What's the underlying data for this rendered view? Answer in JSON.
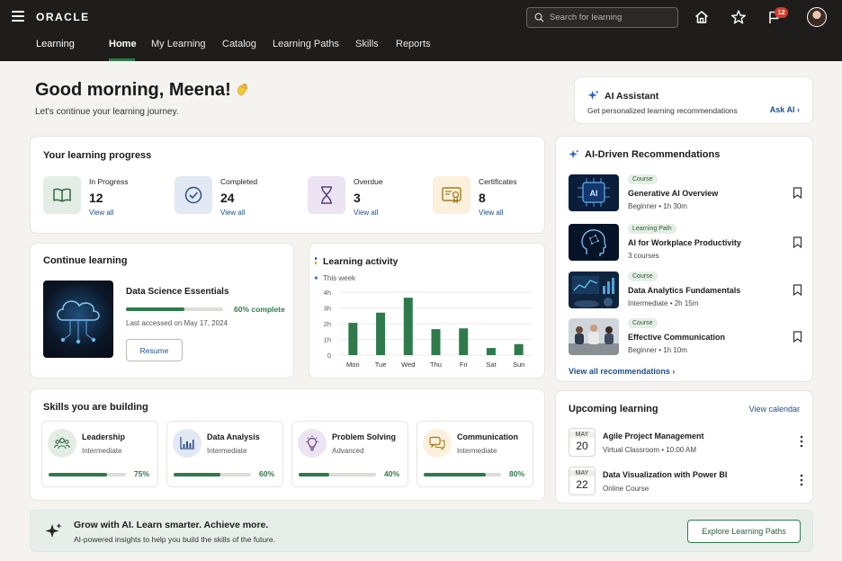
{
  "header": {
    "logo": "ORACLE",
    "search_placeholder": "Search for learning",
    "notification_count": "12",
    "app_name": "Learning",
    "tabs": [
      {
        "label": "Home",
        "active": true
      },
      {
        "label": "My Learning"
      },
      {
        "label": "Catalog"
      },
      {
        "label": "Learning Paths"
      },
      {
        "label": "Skills"
      },
      {
        "label": "Reports"
      }
    ]
  },
  "greeting": {
    "title": "Good morning, Meena!",
    "subtitle": "Let's continue your learning journey."
  },
  "ai_assistant": {
    "title": "AI Assistant",
    "subtitle": "Get personalized learning recommendations",
    "link": "Ask AI"
  },
  "progress": {
    "title": "Your learning progress",
    "stats": [
      {
        "label": "In Progress",
        "value": "12",
        "link": "View all",
        "icon": "book-icon",
        "color": "#e3ede5"
      },
      {
        "label": "Completed",
        "value": "24",
        "link": "View all",
        "icon": "check-circle-icon",
        "color": "#e2e9f5"
      },
      {
        "label": "Overdue",
        "value": "3",
        "link": "View all",
        "icon": "hourglass-icon",
        "color": "#ece4f2"
      },
      {
        "label": "Certificates",
        "value": "8",
        "link": "View all",
        "icon": "certificate-icon",
        "color": "#fbf0dc"
      }
    ]
  },
  "continue": {
    "title": "Continue learning",
    "course": "Data Science Essentials",
    "progress_pct": 60,
    "progress_label": "60% complete",
    "last_accessed": "Last accessed on May 17, 2024",
    "resume": "Resume"
  },
  "chart_data": {
    "type": "bar",
    "title": "Learning activity",
    "legend": "This week",
    "categories": [
      "Mon",
      "Tue",
      "Wed",
      "Thu",
      "Fri",
      "Sat",
      "Sun"
    ],
    "values": [
      2.05,
      2.7,
      3.65,
      1.65,
      1.7,
      0.45,
      0.7
    ],
    "yticks": [
      "4h",
      "3h",
      "2h",
      "1h",
      "0"
    ],
    "ylim": [
      0,
      4
    ],
    "color": "#2f7a4a"
  },
  "recommendations": {
    "title": "AI-Driven Recommendations",
    "items": [
      {
        "tag": "Course",
        "name": "Generative AI Overview",
        "meta": "Beginner  •  1h 30m"
      },
      {
        "tag": "Learning Path",
        "name": "AI for Workplace Productivity",
        "meta": "3 courses"
      },
      {
        "tag": "Course",
        "name": "Data Analytics Fundamentals",
        "meta": "Intermediate  •  2h 15m"
      },
      {
        "tag": "Course",
        "name": "Effective Communication",
        "meta": "Beginner  •  1h 10m"
      }
    ],
    "view_all": "View all recommendations"
  },
  "skills": {
    "title": "Skills you are building",
    "items": [
      {
        "name": "Leadership",
        "level": "Intermediate",
        "pct": 75,
        "pct_label": "75%",
        "icon": "team-icon",
        "color": "#e3ede5"
      },
      {
        "name": "Data Analysis",
        "level": "Intermediate",
        "pct": 60,
        "pct_label": "60%",
        "icon": "chart-icon",
        "color": "#e2e9f5"
      },
      {
        "name": "Problem Solving",
        "level": "Advanced",
        "pct": 40,
        "pct_label": "40%",
        "icon": "lightbulb-icon",
        "color": "#ece4f2"
      },
      {
        "name": "Communication",
        "level": "Intermediate",
        "pct": 80,
        "pct_label": "80%",
        "icon": "chat-icon",
        "color": "#fbf0dc"
      }
    ]
  },
  "upcoming": {
    "title": "Upcoming learning",
    "link": "View calendar",
    "events": [
      {
        "month": "MAY",
        "day": "20",
        "name": "Agile Project Management",
        "meta": "Virtual Classroom  •  10:00 AM"
      },
      {
        "month": "MAY",
        "day": "22",
        "name": "Data Visualization with Power BI",
        "meta": "Online Course"
      }
    ]
  },
  "banner": {
    "title": "Grow with AI. Learn smarter. Achieve more.",
    "subtitle": "AI-powered insights to help you build the skills of the future.",
    "button": "Explore Learning Paths"
  }
}
